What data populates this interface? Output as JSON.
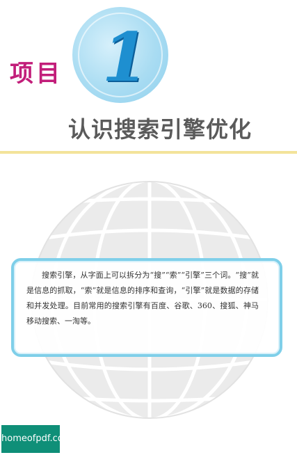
{
  "chapter": {
    "label": "项目",
    "number": "1",
    "title": "认识搜索引擎优化"
  },
  "intro": {
    "text": "搜索引擎，从字面上可以拆分为“搜”“索”“引擎”三个词。“搜”就是信息的抓取，“索”就是信息的排序和查询，“引擎”就是数据的存储和并发处理。目前常用的搜索引擎有百度、谷歌、360、搜狐、神马移动搜索、一淘等。"
  },
  "watermark": {
    "text": "homeofpdf.com"
  },
  "colors": {
    "chapter_label": "#c21e7a",
    "chapter_number": "#1e8fd0",
    "circle": "#a9dcf2",
    "title": "#5a5a5a",
    "rule": "#f3e39a",
    "callout_border": "#7fcfe9",
    "globe": "#dcdcdc",
    "watermark_bg": "#0f8f78"
  },
  "icons": {
    "background_graphic": "globe-icon"
  }
}
